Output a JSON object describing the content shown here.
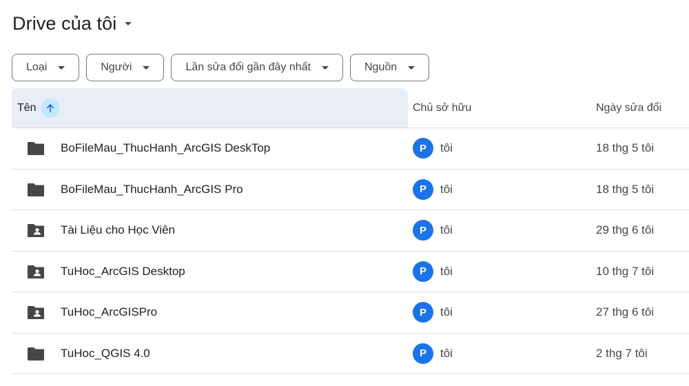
{
  "header": {
    "title": "Drive của tôi"
  },
  "filters": [
    {
      "label": "Loại"
    },
    {
      "label": "Người"
    },
    {
      "label": "Lần sửa đổi gần đây nhất"
    },
    {
      "label": "Nguồn"
    }
  ],
  "table": {
    "columns": {
      "name": "Tên",
      "owner": "Chủ sở hữu",
      "modified": "Ngày sửa đổi"
    },
    "sort": {
      "column": "name",
      "direction": "ascending"
    },
    "rows": [
      {
        "icon": "folder-icon",
        "name": "BoFileMau_ThucHanh_ArcGIS DeskTop",
        "owner_initial": "P",
        "owner": "tôi",
        "modified": "18 thg 5 tôi"
      },
      {
        "icon": "folder-icon",
        "name": "BoFileMau_ThucHanh_ArcGIS Pro",
        "owner_initial": "P",
        "owner": "tôi",
        "modified": "18 thg 5 tôi"
      },
      {
        "icon": "shared-folder-icon",
        "name": "Tài Liệu cho Học Viên",
        "owner_initial": "P",
        "owner": "tôi",
        "modified": "29 thg 6 tôi"
      },
      {
        "icon": "shared-folder-icon",
        "name": "TuHoc_ArcGIS Desktop",
        "owner_initial": "P",
        "owner": "tôi",
        "modified": "10 thg 7 tôi"
      },
      {
        "icon": "shared-folder-icon",
        "name": "TuHoc_ArcGISPro",
        "owner_initial": "P",
        "owner": "tôi",
        "modified": "27 thg 6 tôi"
      },
      {
        "icon": "folder-icon",
        "name": "TuHoc_QGIS 4.0",
        "owner_initial": "P",
        "owner": "tôi",
        "modified": "2 thg 7 tôi"
      }
    ]
  },
  "colors": {
    "avatar": "#1a73e8",
    "header_highlight": "#e9eef6",
    "sort_button": "#c2e7ff",
    "folder": "#444746"
  }
}
